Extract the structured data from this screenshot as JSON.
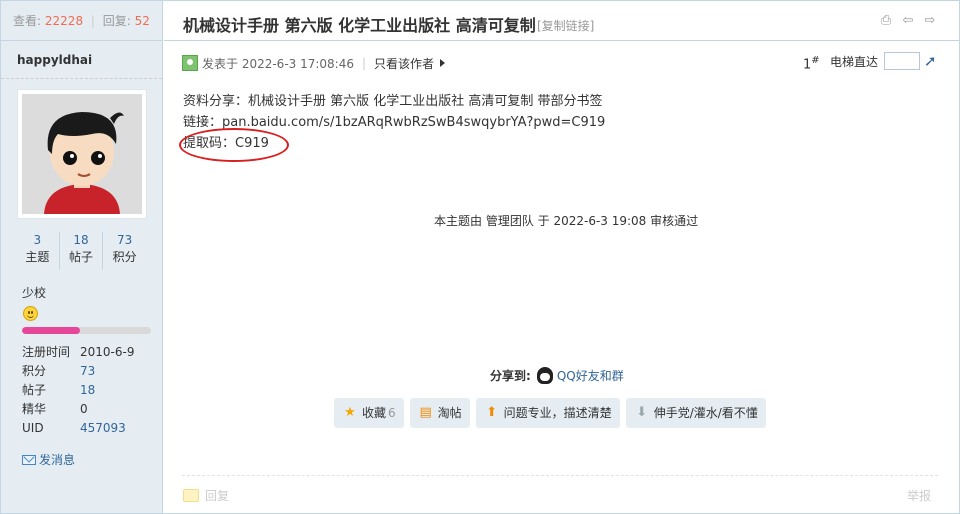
{
  "stats": {
    "views_label": "查看:",
    "views": "22228",
    "replies_label": "回复:",
    "replies": "52"
  },
  "thread": {
    "title": "机械设计手册 第六版 化学工业出版社 高清可复制",
    "copy_link": "[复制链接]"
  },
  "author": {
    "name": "happyldhai",
    "counts": [
      {
        "value": "3",
        "label": "主题"
      },
      {
        "value": "18",
        "label": "帖子"
      },
      {
        "value": "73",
        "label": "积分"
      }
    ],
    "rank": "少校",
    "level_progress_percent": 45,
    "profile": [
      {
        "key": "注册时间",
        "value": "2010-6-9"
      },
      {
        "key": "积分",
        "value": "73"
      },
      {
        "key": "帖子",
        "value": "18"
      },
      {
        "key": "精华",
        "value": "0"
      },
      {
        "key": "UID",
        "value": "457093"
      }
    ],
    "send_message": "发消息"
  },
  "post": {
    "posted_at": "发表于 2022-6-3 17:08:46",
    "only_author": "只看该作者",
    "floor": "1",
    "floor_mark": "#",
    "elevator_label": "电梯直达",
    "lines": [
      "资料分享：机械设计手册 第六版 化学工业出版社 高清可复制 带部分书签",
      "链接：pan.baidu.com/s/1bzARqRwbRzSwB4swqybrYA?pwd=C919",
      "提取码：C919"
    ],
    "audit": "本主题由 管理团队 于 2022-6-3 19:08 审核通过"
  },
  "share": {
    "label": "分享到:",
    "qq": "QQ好友和群"
  },
  "actions": {
    "favorite": "收藏",
    "favorite_count": "6",
    "tao": "淘帖",
    "good": "问题专业，描述清楚",
    "bad": "伸手党/灌水/看不懂"
  },
  "footer": {
    "reply": "回复",
    "report": "举报"
  }
}
